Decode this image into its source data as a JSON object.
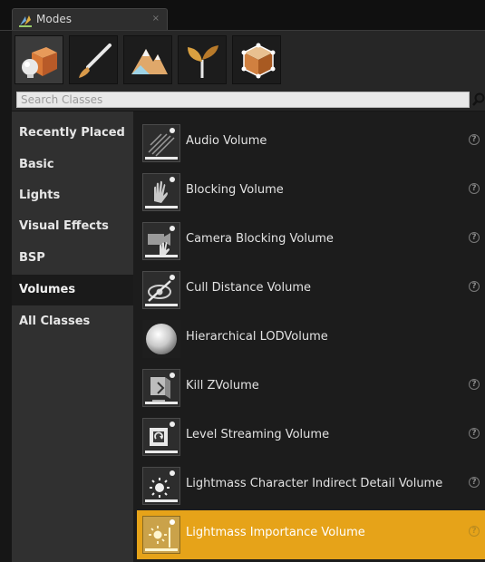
{
  "window": {
    "tab_title": "Modes",
    "tab_close": "×"
  },
  "toolbar": {
    "modes": [
      {
        "icon": "place-mode-icon",
        "active": true
      },
      {
        "icon": "paint-mode-icon",
        "active": false
      },
      {
        "icon": "landscape-mode-icon",
        "active": false
      },
      {
        "icon": "foliage-mode-icon",
        "active": false
      },
      {
        "icon": "geometry-mode-icon",
        "active": false
      }
    ]
  },
  "search": {
    "placeholder": "Search Classes",
    "value": ""
  },
  "categories": [
    {
      "label": "Recently Placed",
      "active": false
    },
    {
      "label": "Basic",
      "active": false
    },
    {
      "label": "Lights",
      "active": false
    },
    {
      "label": "Visual Effects",
      "active": false
    },
    {
      "label": "BSP",
      "active": false
    },
    {
      "label": "Volumes",
      "active": true
    },
    {
      "label": "All Classes",
      "active": false
    }
  ],
  "items": [
    {
      "label": "Audio Volume",
      "icon": "audio-volume-icon",
      "has_help": true,
      "selected": false
    },
    {
      "label": "Blocking Volume",
      "icon": "blocking-volume-icon",
      "has_help": true,
      "selected": false
    },
    {
      "label": "Camera Blocking Volume",
      "icon": "camera-blocking-volume-icon",
      "has_help": true,
      "selected": false
    },
    {
      "label": "Cull Distance Volume",
      "icon": "cull-distance-volume-icon",
      "has_help": true,
      "selected": false
    },
    {
      "label": "Hierarchical LODVolume",
      "icon": "sphere-icon",
      "has_help": false,
      "selected": false
    },
    {
      "label": "Kill ZVolume",
      "icon": "kill-z-volume-icon",
      "has_help": true,
      "selected": false
    },
    {
      "label": "Level Streaming Volume",
      "icon": "level-streaming-volume-icon",
      "has_help": true,
      "selected": false
    },
    {
      "label": "Lightmass Character Indirect Detail Volume",
      "icon": "lightmass-character-volume-icon",
      "has_help": true,
      "selected": false
    },
    {
      "label": "Lightmass Importance Volume",
      "icon": "lightmass-importance-volume-icon",
      "has_help": true,
      "selected": true
    }
  ],
  "help_glyph": "?",
  "colors": {
    "selection": "#e6a319",
    "background": "#1c1c1c",
    "sidebar": "#303030"
  }
}
